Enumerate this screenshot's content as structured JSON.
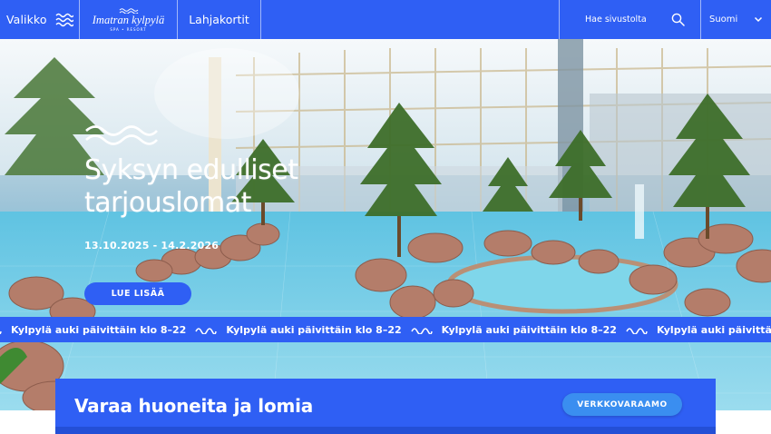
{
  "header": {
    "menu_label": "Valikko",
    "logo_main": "Imatran kylpylä",
    "logo_sub": "SPA • RESORT",
    "gift_cards": "Lahjakortit",
    "search_label": "Hae sivustolta",
    "language": "Suomi"
  },
  "hero": {
    "title": "Syksyn edulliset tarjouslomat",
    "dates": "13.10.2025 - 14.2.2026",
    "cta": "LUE LISÄÄ"
  },
  "ticker": {
    "text": "Kylpylä auki päivittäin klo 8–22",
    "visible_repeats": 5
  },
  "booking": {
    "title": "Varaa huoneita ja lomia",
    "cta": "VERKKOVARAAMO"
  },
  "colors": {
    "brand_blue": "#2f5ff4",
    "button_light_blue": "#3a8ef0",
    "white": "#ffffff"
  },
  "icons": [
    "wave-menu-icon",
    "logo-wave-icon",
    "search-icon",
    "chevron-down-icon",
    "wave-icon"
  ]
}
